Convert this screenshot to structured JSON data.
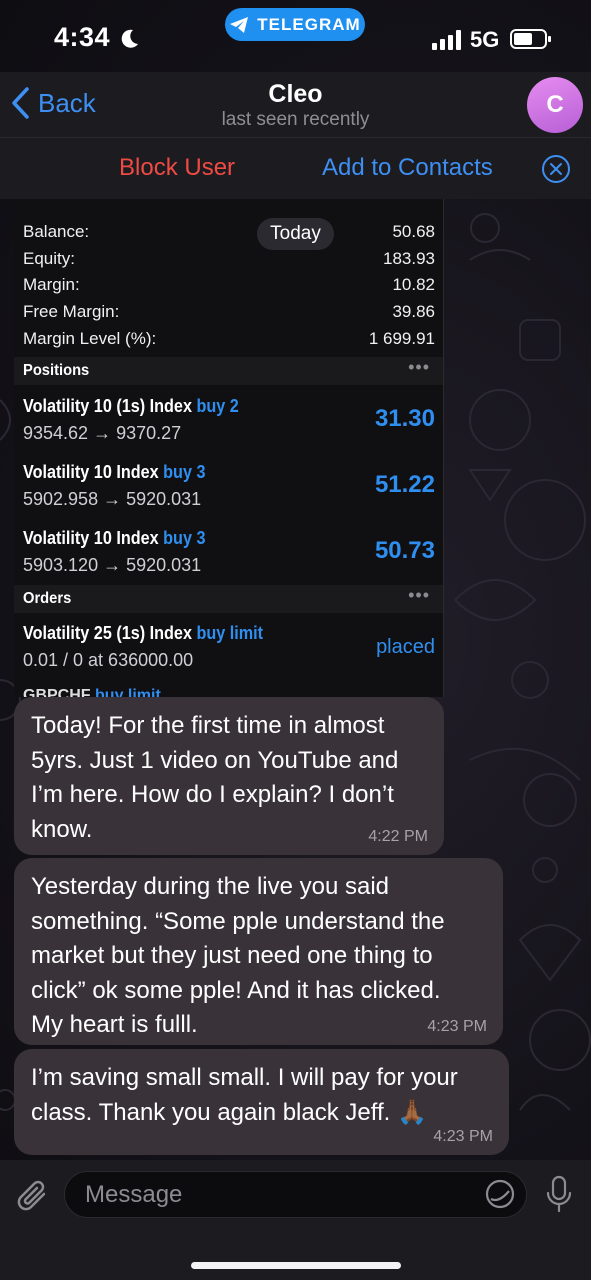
{
  "status_bar": {
    "time": "4:34",
    "app_pill": "TELEGRAM",
    "network": "5G"
  },
  "header": {
    "back_label": "Back",
    "contact_name": "Cleo",
    "last_seen": "last seen recently",
    "avatar_letter": "C"
  },
  "action_bar": {
    "block_label": "Block User",
    "add_label": "Add to Contacts"
  },
  "shot": {
    "account": [
      {
        "label": "Balance:",
        "value": "50.68"
      },
      {
        "label": "Equity:",
        "value": "183.93"
      },
      {
        "label": "Margin:",
        "value": "10.82"
      },
      {
        "label": "Free Margin:",
        "value": "39.86"
      },
      {
        "label": "Margin Level (%):",
        "value": "1 699.91"
      }
    ],
    "today_badge": "Today",
    "positions_header": "Positions",
    "positions": [
      {
        "name": "Volatility 10 (1s) Index",
        "dir": "buy 2",
        "prices": "9354.62 → 9370.27",
        "profit": "31.30"
      },
      {
        "name": "Volatility 10 Index",
        "dir": "buy 3",
        "prices": "5902.958 → 5920.031",
        "profit": "51.22"
      },
      {
        "name": "Volatility 10 Index",
        "dir": "buy 3",
        "prices": "5903.120 → 5920.031",
        "profit": "50.73"
      }
    ],
    "orders_header": "Orders",
    "orders": [
      {
        "name": "Volatility 25 (1s) Index",
        "dir": "buy limit",
        "detail": "0.01 / 0 at 636000.00",
        "status": "placed"
      }
    ],
    "cut_off_order": {
      "name": "GBPCHF",
      "dir": "buy limit"
    },
    "dots": "•••"
  },
  "messages": [
    {
      "text": "Today! For the first time in almost\n5yrs. Just 1 video on YouTube and\nI’m here. How do I explain? I don’t\nknow.",
      "time": "4:22 PM"
    },
    {
      "text": "Yesterday during the live you said\nsomething. “Some pple understand the\nmarket but they just need one thing to\nclick” ok some pple! And it has clicked.\nMy heart is fulll.",
      "time": "4:23 PM"
    },
    {
      "text": "I’m saving small small. I will pay for your\nclass. Thank you again black Jeff. 🙏🏾",
      "time": "4:23 PM"
    }
  ],
  "composer": {
    "placeholder": "Message"
  },
  "colors": {
    "accent": "#3e8ff2",
    "danger": "#ef4a44",
    "bubble": "#3a3239",
    "profit_blue": "#2f8ff0"
  },
  "icons": [
    "moon-icon",
    "telegram-icon",
    "signal-icon",
    "battery-icon",
    "chevron-left-icon",
    "close-circle-icon",
    "paperclip-icon",
    "sticker-icon",
    "microphone-icon"
  ]
}
